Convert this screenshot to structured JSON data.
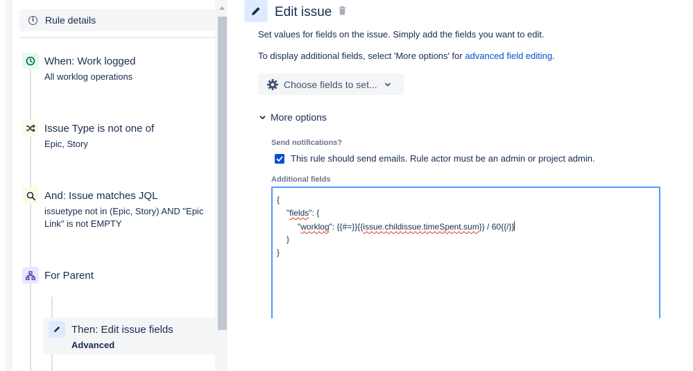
{
  "sidebar": {
    "rule_details_label": "Rule details",
    "nodes": [
      {
        "title": "When: Work logged",
        "subtitle": "All worklog operations",
        "icon": "clock-icon"
      },
      {
        "title": "Issue Type is not one of",
        "subtitle": "Epic, Story",
        "icon": "shuffle-icon"
      },
      {
        "title": "And: Issue matches JQL",
        "subtitle_line1": "issuetype not in (Epic, Story) AND \"Epic",
        "subtitle_line2": "Link\" is not EMPTY",
        "icon": "search-icon"
      },
      {
        "title": "For Parent",
        "icon": "hierarchy-icon"
      },
      {
        "title": "Then: Edit issue fields",
        "subtitle": "Advanced",
        "icon": "pencil-icon"
      }
    ]
  },
  "main": {
    "title": "Edit issue",
    "desc1": "Set values for fields on the issue. Simply add the fields you want to edit.",
    "desc2_prefix": "To display additional fields, select 'More options' for ",
    "desc2_link": "advanced field editing",
    "desc2_suffix": ".",
    "choose_fields_label": "Choose fields to set...",
    "more_options_label": "More options",
    "send_notifications_label": "Send notifications?",
    "send_notifications_text": "This rule should send emails. Rule actor must be an admin or project admin.",
    "send_notifications_checked": true,
    "additional_fields_label": "Additional fields",
    "code": {
      "line1": "{",
      "line2_quote_open": "\"",
      "line2_key": "fields",
      "line2_rest": "\": {",
      "line3_quote_open": "\"",
      "line3_key": "worklog",
      "line3_mid": "\": {{#=}}{{",
      "line3_expr": "issue.childissue.timeSpent.sum",
      "line3_end": "}} / 60{{/}}",
      "line4": "}",
      "line5": "}"
    }
  },
  "colors": {
    "accent": "#0052cc",
    "focus_border": "#4c9aff",
    "trigger_icon_bg": "#e3fcef",
    "condition_icon_bg": "#fffae6",
    "branch_icon_bg": "#eae6ff",
    "action_icon_bg": "#deebff"
  }
}
